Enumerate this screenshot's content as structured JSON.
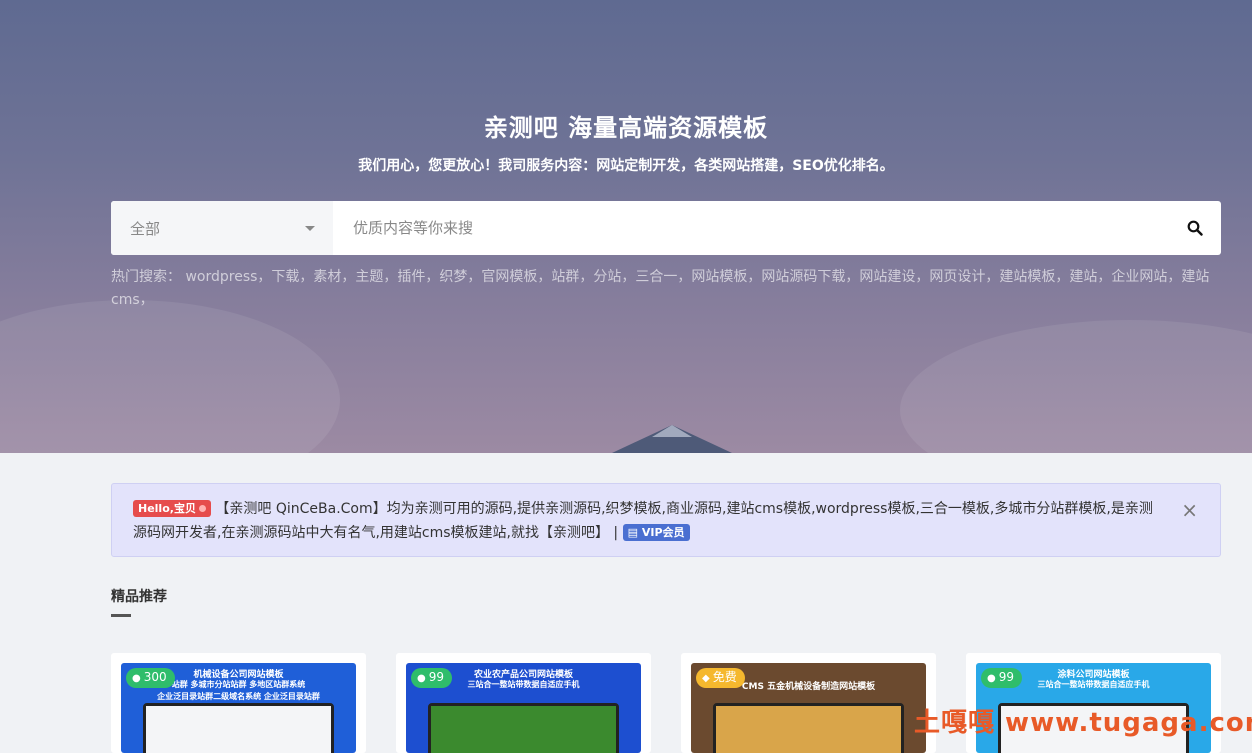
{
  "hero": {
    "title": "亲测吧 海量高端资源模板",
    "subtitle": "我们用心，您更放心！我司服务内容：网站定制开发，各类网站搭建，SEO优化排名。"
  },
  "search": {
    "category": "全部",
    "placeholder": "优质内容等你来搜",
    "button_icon": "search-icon"
  },
  "hot_search": {
    "label": "热门搜索：",
    "keywords": "wordpress，下载，素材，主题，插件，织梦，官网模板，站群，分站，三合一，网站模板，网站源码下载，网站建设，网页设计，建站模板，建站，企业网站，建站cms，"
  },
  "notice": {
    "badge": "Hello,宝贝",
    "text": "【亲测吧 QinCeBa.Com】均为亲测可用的源码,提供亲测源码,织梦模板,商业源码,建站cms模板,wordpress模板,三合一模板,多城市分站群模板,是亲测源码网开发者,在亲测源码站中大有名气,用建站cms模板建站,就找【亲测吧】 |",
    "vip_label": "VIP会员",
    "close": "×"
  },
  "section": {
    "title": "精品推荐"
  },
  "cards": [
    {
      "price": "300",
      "free": false,
      "line1": "机械设备公司网站模板",
      "line2": "站群 多城市分站站群 多地区站群系统",
      "line3": "企业泛目录站群二级域名系统  企业泛目录站群",
      "bg": "#1f5fd8"
    },
    {
      "price": "99",
      "free": false,
      "line1": "农业农产品公司网站模板",
      "line2": "三站合一整站带数据自适应手机",
      "line3": "",
      "bg": "#1d4fd0"
    },
    {
      "price": "免费",
      "free": true,
      "line1": "CMS 五金机械设备制造网站模板",
      "line2": "",
      "line3": "",
      "bg": "#6b4a2f"
    },
    {
      "price": "99",
      "free": false,
      "line1": "涂料公司网站模板",
      "line2": "三站合一整站带数据自适应手机",
      "line3": "",
      "bg": "#29a8e8"
    }
  ],
  "watermark": "土嘎嘎 www.tugaga.com",
  "colors": {
    "accent_green": "#2fbd6b",
    "accent_gold": "#f5b82e",
    "notice_bg": "#e3e3fb",
    "badge_red": "#e64c4c",
    "vip_blue": "#4a6fd1"
  }
}
